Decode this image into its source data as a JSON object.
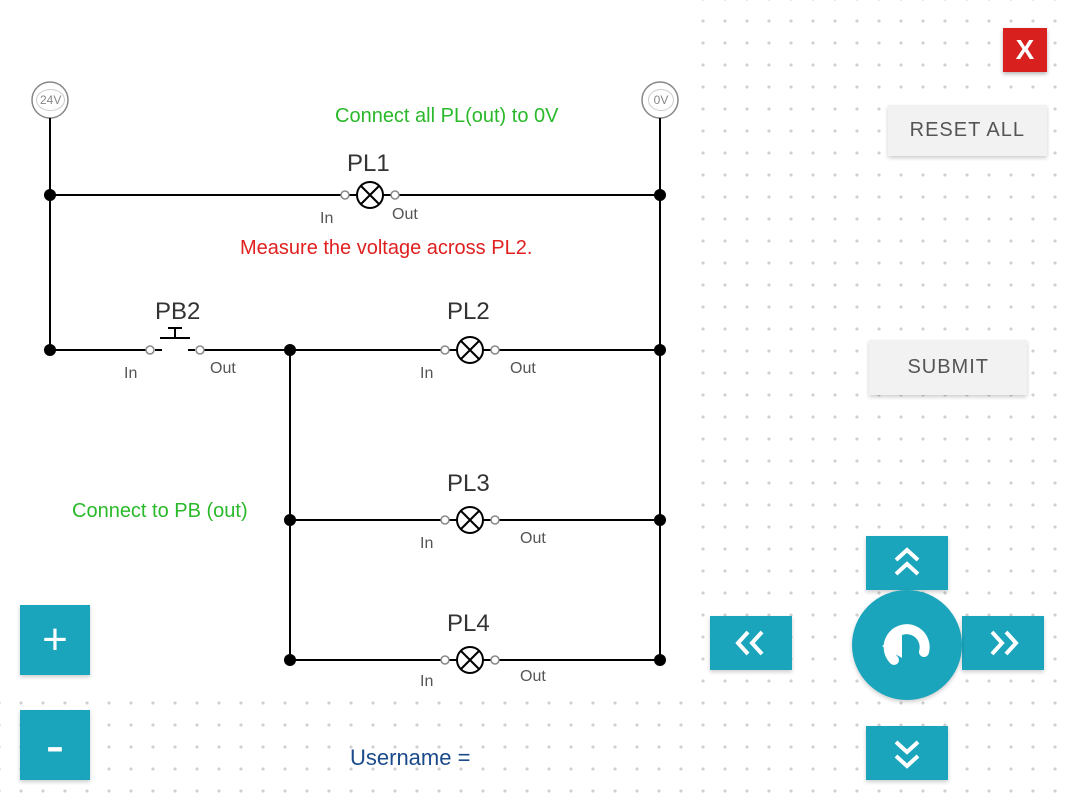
{
  "circuit": {
    "source_left": "24V",
    "source_right": "0V",
    "hint_top": "Connect all PL(out) to 0V",
    "hint_mid": "Measure the voltage across PL2.",
    "hint_left": "Connect to PB (out)",
    "components": {
      "pl1": {
        "name": "PL1",
        "in": "In",
        "out": "Out"
      },
      "pb2": {
        "name": "PB2",
        "in": "In",
        "out": "Out"
      },
      "pl2": {
        "name": "PL2",
        "in": "In",
        "out": "Out"
      },
      "pl3": {
        "name": "PL3",
        "in": "In",
        "out": "Out"
      },
      "pl4": {
        "name": "PL4",
        "in": "In",
        "out": "Out"
      }
    }
  },
  "footer": {
    "username_label": "Username =",
    "username_value": ""
  },
  "buttons": {
    "close": "X",
    "reset_all": "RESET ALL",
    "submit": "SUBMIT",
    "zoom_in": "+",
    "zoom_out": "-"
  }
}
